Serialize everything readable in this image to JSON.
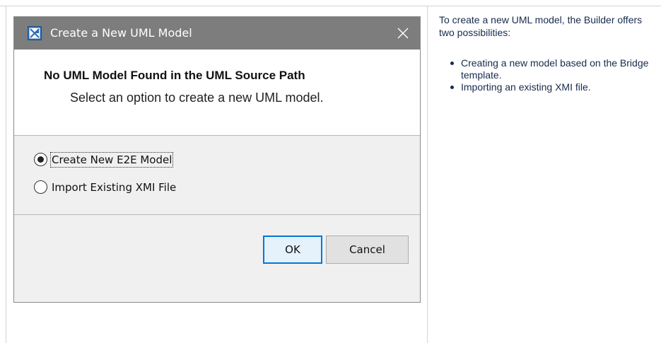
{
  "dialog": {
    "title": "Create a New UML Model",
    "heading": "No UML Model Found in the UML Source Path",
    "description": "Select an option to create a new UML model.",
    "options": [
      {
        "label": "Create New E2E Model",
        "selected": true
      },
      {
        "label": "Import Existing XMI File",
        "selected": false
      }
    ],
    "ok_label": "OK",
    "cancel_label": "Cancel"
  },
  "info": {
    "intro": "To create a new UML model, the Builder offers two possibilities:",
    "bullets": [
      "Creating a new model based on the Bridge template.",
      "Importing an existing XMI file."
    ]
  },
  "colors": {
    "titlebar": "#7d7d7d",
    "accent": "#0078d7",
    "text": "#172b4d"
  }
}
